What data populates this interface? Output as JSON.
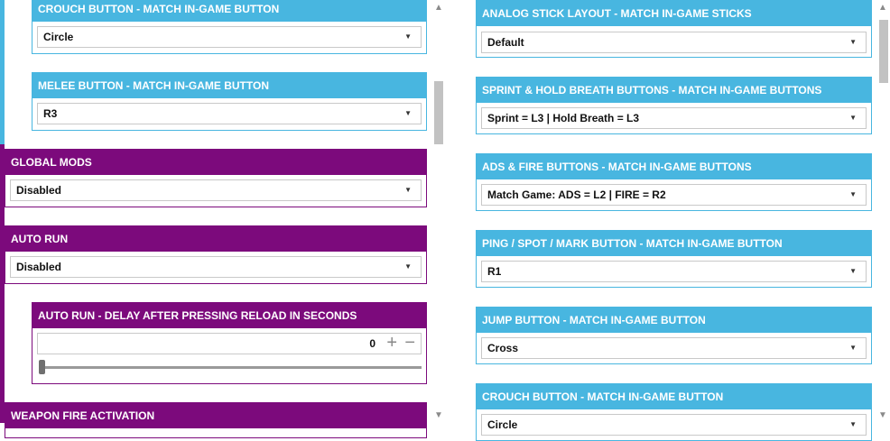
{
  "left_panel": {
    "crouch": {
      "title": "CROUCH BUTTON - MATCH IN-GAME BUTTON",
      "value": "Circle"
    },
    "melee": {
      "title": "MELEE BUTTON - MATCH IN-GAME BUTTON",
      "value": "R3"
    },
    "global_mods": {
      "title": "GLOBAL MODS",
      "value": "Disabled"
    },
    "auto_run": {
      "title": "AUTO RUN",
      "value": "Disabled"
    },
    "auto_run_delay": {
      "title": "AUTO RUN - DELAY AFTER PRESSING RELOAD IN SECONDS",
      "value": "0",
      "plus": "+",
      "minus": "−",
      "slider_fraction": 0
    },
    "weapon_fire": {
      "title": "WEAPON FIRE ACTIVATION"
    }
  },
  "right_panel": {
    "analog": {
      "title": "ANALOG STICK LAYOUT - MATCH IN-GAME STICKS",
      "value": "Default"
    },
    "sprint": {
      "title": "SPRINT & HOLD BREATH BUTTONS - MATCH IN-GAME BUTTONS",
      "value": "Sprint = L3  |  Hold Breath = L3"
    },
    "ads_fire": {
      "title": "ADS & FIRE BUTTONS - MATCH IN-GAME BUTTONS",
      "value": "Match Game: ADS = L2  |  FIRE = R2"
    },
    "ping": {
      "title": "PING / SPOT / MARK BUTTON - MATCH IN-GAME BUTTON",
      "value": "R1"
    },
    "jump": {
      "title": "JUMP BUTTON - MATCH IN-GAME BUTTON",
      "value": "Cross"
    },
    "crouch": {
      "title": "CROUCH BUTTON - MATCH IN-GAME BUTTON",
      "value": "Circle"
    }
  },
  "icons": {
    "dropdown_caret": "▼",
    "scroll_up": "▲",
    "scroll_down": "▼"
  },
  "colors": {
    "blue_header": "#48b6e0",
    "purple_header": "#7c0a7c"
  }
}
